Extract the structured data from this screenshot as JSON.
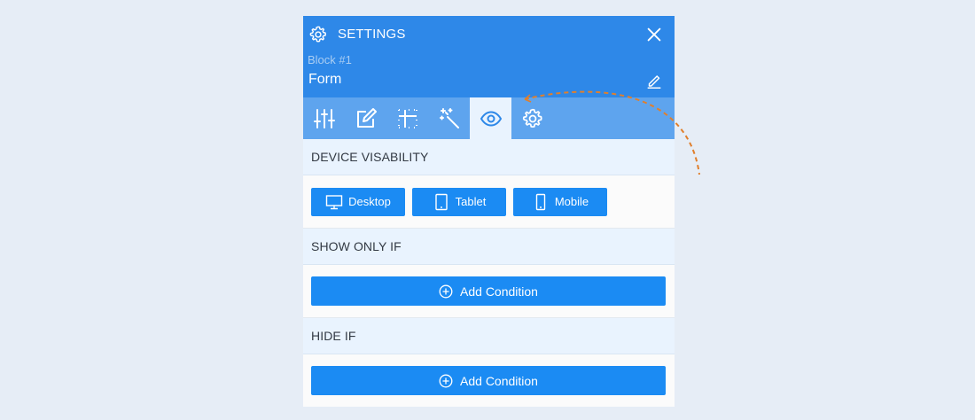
{
  "header": {
    "title": "SETTINGS",
    "block_label": "Block #1",
    "block_name": "Form"
  },
  "tabs": [
    {
      "name": "sliders",
      "icon": "sliders-icon",
      "active": false
    },
    {
      "name": "edit",
      "icon": "edit-icon",
      "active": false
    },
    {
      "name": "layout",
      "icon": "grid-icon",
      "active": false
    },
    {
      "name": "effects",
      "icon": "magic-wand-icon",
      "active": false
    },
    {
      "name": "visibility",
      "icon": "eye-icon",
      "active": true
    },
    {
      "name": "advanced",
      "icon": "gear-icon",
      "active": false
    }
  ],
  "device_visibility": {
    "heading": "DEVICE VISABILITY",
    "desktop_label": "Desktop",
    "tablet_label": "Tablet",
    "mobile_label": "Mobile"
  },
  "show_only_if": {
    "heading": "SHOW ONLY IF",
    "add_label": "Add Condition"
  },
  "hide_if": {
    "heading": "HIDE IF",
    "add_label": "Add Condition"
  },
  "colors": {
    "header_bg": "#2e88e8",
    "tabs_bg": "#5ea4ee",
    "button_bg": "#1b8bf3",
    "accent_arrow": "#e07f2c"
  }
}
